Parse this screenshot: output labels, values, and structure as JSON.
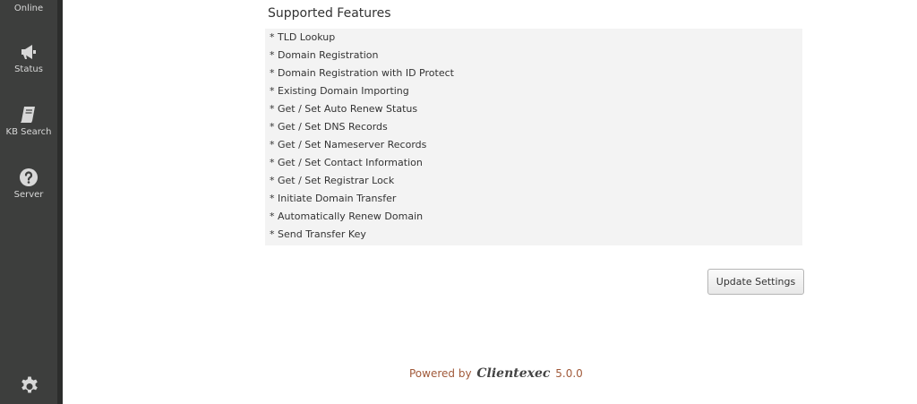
{
  "sidebar": {
    "items": [
      {
        "label": "Online",
        "icon": "online-icon"
      },
      {
        "label": "Status",
        "icon": "megaphone-icon"
      },
      {
        "label": "KB Search",
        "icon": "book-icon"
      },
      {
        "label": "Server",
        "icon": "question-icon"
      }
    ],
    "settings_icon": "gear-icon"
  },
  "main": {
    "section_title": "Supported Features",
    "features": [
      "* TLD Lookup",
      "* Domain Registration",
      "* Domain Registration with ID Protect",
      "* Existing Domain Importing",
      "* Get / Set Auto Renew Status",
      "* Get / Set DNS Records",
      "* Get / Set Nameserver Records",
      "* Get / Set Contact Information",
      "* Get / Set Registrar Lock",
      "* Initiate Domain Transfer",
      "* Automatically Renew Domain",
      "* Send Transfer Key"
    ],
    "update_button": "Update Settings"
  },
  "footer": {
    "powered_by": "Powered by",
    "brand": "Clientexec",
    "version": "5.0.0"
  },
  "colors": {
    "sidebar_bg": "#3d3e3d",
    "features_bg": "#f3f3f3",
    "footer_text": "#a15a3a"
  }
}
